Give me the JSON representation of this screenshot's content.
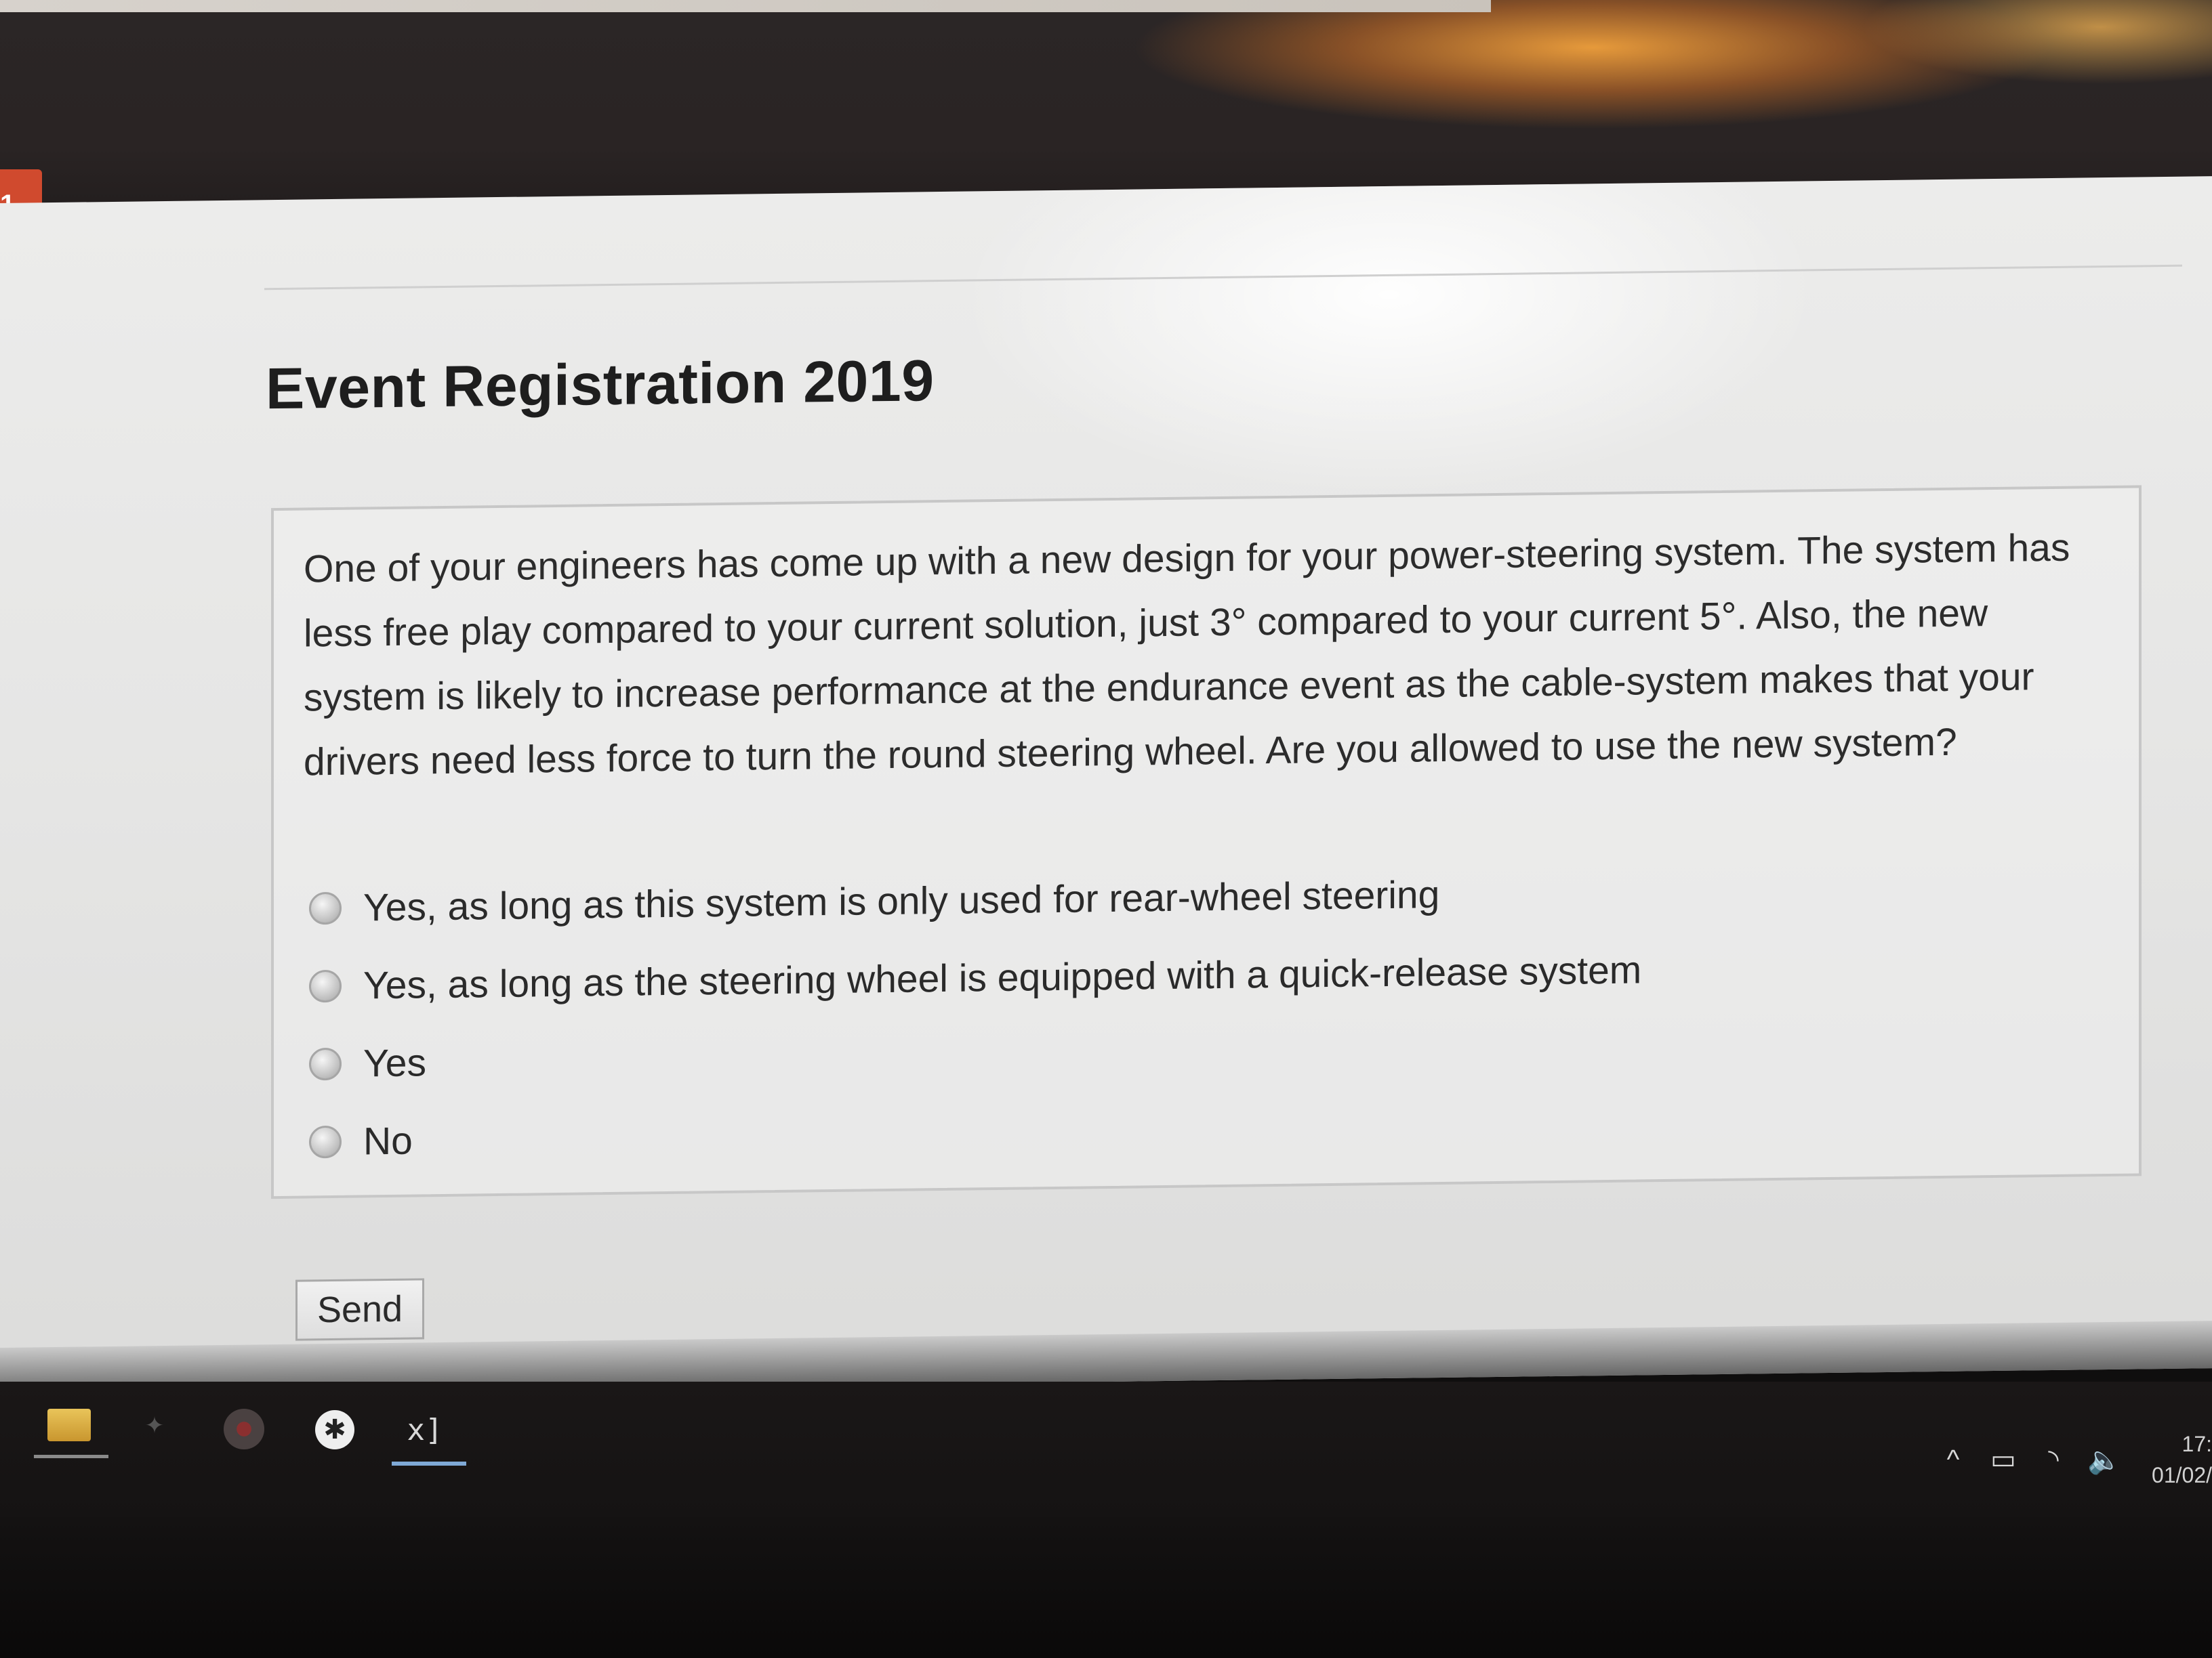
{
  "page_title": "Event Registration 2019",
  "question": {
    "text": "One of your engineers has come up with a new design for your power-steering system. The system has less free play compared to your current solution, just 3° compared to your current 5°. Also, the new system is likely to increase performance at the endurance event as the cable-system makes that your drivers need less force to turn the round steering wheel. Are you allowed to use the new system?",
    "options": [
      {
        "label": "Yes, as long as this system is only used for rear-wheel steering",
        "selected": false
      },
      {
        "label": "Yes, as long as the steering wheel is equipped with a quick-release system",
        "selected": false
      },
      {
        "label": "Yes",
        "selected": false
      },
      {
        "label": "No",
        "selected": false
      }
    ]
  },
  "send_label": "Send",
  "browser": {
    "tab_glyph": "1"
  },
  "taskbar": {
    "icons": [
      "file-explorer-icon",
      "pin-icon",
      "chrome-icon",
      "settings-gear-icon",
      "excel-icon"
    ],
    "excel_glyph": "x]",
    "tray": {
      "chevron": "^",
      "battery": "▭",
      "wifi": "◝",
      "volume": "🔈"
    },
    "clock_time": "17:",
    "clock_date": "01/02/"
  },
  "colors": {
    "page_bg": "#e6e6e5",
    "text": "#2c2c2c",
    "tab_accent": "#d04a2e",
    "taskbar_bg": "#1a1717",
    "active_underline": "#7fa9d6"
  }
}
